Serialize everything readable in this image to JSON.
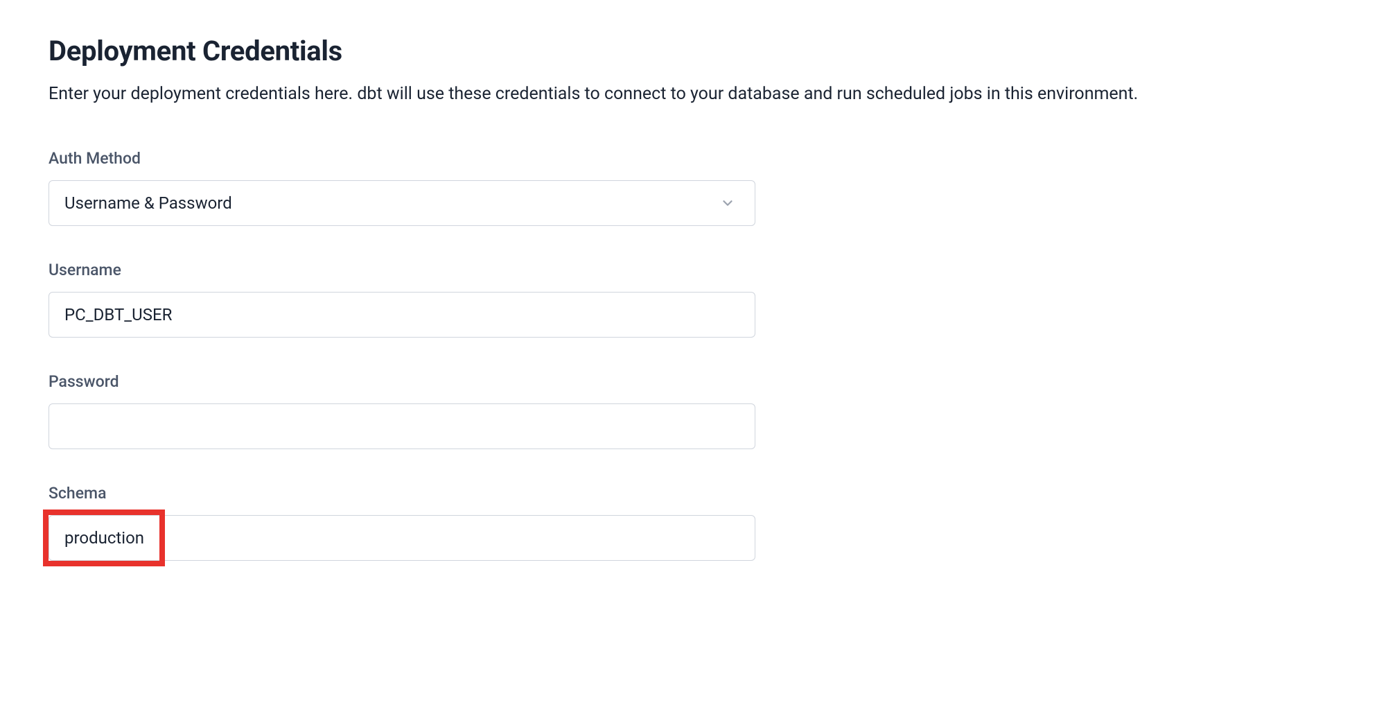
{
  "header": {
    "title": "Deployment Credentials",
    "description": "Enter your deployment credentials here. dbt will use these credentials to connect to your database and run scheduled jobs in this environment."
  },
  "form": {
    "auth_method": {
      "label": "Auth Method",
      "selected_value": "Username & Password"
    },
    "username": {
      "label": "Username",
      "value": "PC_DBT_USER"
    },
    "password": {
      "label": "Password",
      "value": ""
    },
    "schema": {
      "label": "Schema",
      "value": "production"
    }
  }
}
